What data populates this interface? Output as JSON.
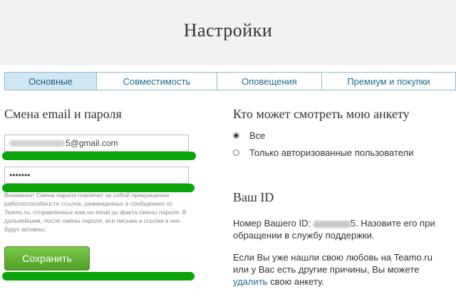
{
  "header": {
    "title": "Настройки"
  },
  "tabs": [
    {
      "label": "Основные",
      "active": true
    },
    {
      "label": "Совместимость",
      "active": false
    },
    {
      "label": "Оповещения",
      "active": false
    },
    {
      "label": "Премиум и покупки",
      "active": false
    }
  ],
  "left": {
    "title": "Смена email и пароля",
    "email_value": "5@gmail.com",
    "password_value": "•••••••",
    "warning": "Внимание! Смена пароля повлечет за собой прекращение работоспособности ссылок, размещенных в сообщениях от Teamo.ru, отправленных вам на email до факта смены пароля. В дальнейшем, после смены пароля, все письма и ссылки в них будут активны.",
    "save_label": "Сохранить"
  },
  "right": {
    "privacy_title": "Кто может смотреть мою анкету",
    "options": [
      {
        "label": "Все",
        "checked": true
      },
      {
        "label": "Только авторизованные пользователи",
        "checked": false
      }
    ],
    "id_title": "Ваш ID",
    "id_prefix": "Номер Вашего ID:",
    "id_tail": "5",
    "id_suffix": ". Назовите его при обращении в службу поддержки.",
    "delete_text_before": "Если Вы уже нашли свою любовь на Teamo.ru или у Вас есть другие причины, Вы можете ",
    "delete_link": "удалить",
    "delete_text_after": " свою анкету."
  },
  "colors": {
    "accent": "#1f6b94",
    "save_button": "#5aaa2e",
    "highlight": "#0aa30a"
  }
}
